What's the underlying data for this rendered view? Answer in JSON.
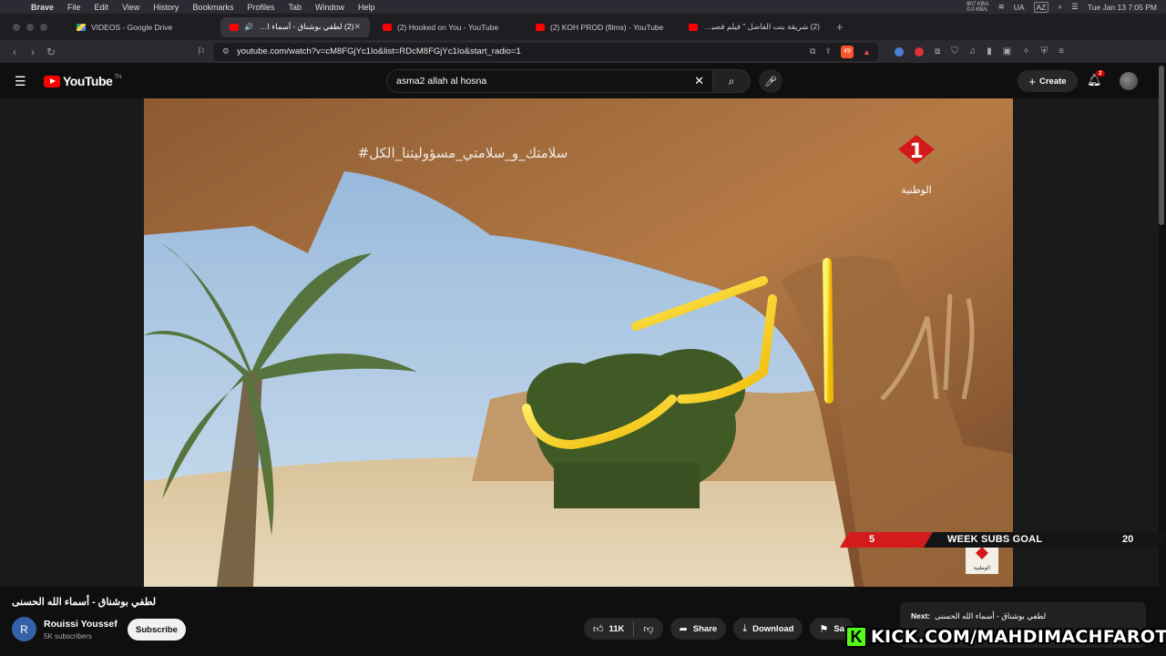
{
  "menubar": {
    "items": [
      "Brave",
      "File",
      "Edit",
      "View",
      "History",
      "Bookmarks",
      "Profiles",
      "Tab",
      "Window",
      "Help"
    ],
    "net_up": "807 KB/s",
    "net_down": "0.0 KB/s",
    "input_lang": "UA",
    "kbd": "AZ",
    "datetime": "Tue Jan 13  7:05 PM"
  },
  "tabs": [
    {
      "title": "VIDEOS - Google Drive",
      "icon": "google-drive-icon"
    },
    {
      "title": "(2) لطفي بوشناق - أسماء الله الحسنى",
      "icon": "youtube-icon",
      "active": true
    },
    {
      "title": "(2) Hooked on You - YouTube",
      "icon": "youtube-icon"
    },
    {
      "title": "(2) KOH PROD (films) - YouTube",
      "icon": "youtube-icon"
    },
    {
      "title": "(2) شريقة بنت الفاضل \" فيلم قصير تو...",
      "icon": "youtube-icon"
    }
  ],
  "address": {
    "url": "youtube.com/watch?v=cM8FGjYc1Io&list=RDcM8FGjYc1Io&start_radio=1",
    "shield_count": "49"
  },
  "youtube": {
    "logo_text": "YouTube",
    "logo_sup": "TN",
    "search_value": "asma2 allah al hosna",
    "create_label": "Create",
    "notif_count": "2"
  },
  "video": {
    "overlay": {
      "goal_left": "5",
      "goal_title": "WEEK SUBS GOAL",
      "goal_right": "20"
    },
    "title": "لطفي بوشناق - أسماء الله الحسنى",
    "channel": {
      "name": "Rouissi Youssef",
      "subs": "5K subscribers",
      "avatar_letter": "R"
    },
    "subscribe_label": "Subscribe",
    "likes": "11K",
    "share_label": "Share",
    "download_label": "Download",
    "save_label": "Sa"
  },
  "up_next": {
    "label": "Next:",
    "title": "لطفي بوشناق - أسماء الله الحسنى"
  },
  "kick_banner": {
    "letter": "K",
    "text": "KICK.COM/MAHDIMACHFAROTB"
  },
  "colors": {
    "yt_red": "#ff0000",
    "kick_green": "#53fc18",
    "goal_red": "#d41b1b"
  }
}
